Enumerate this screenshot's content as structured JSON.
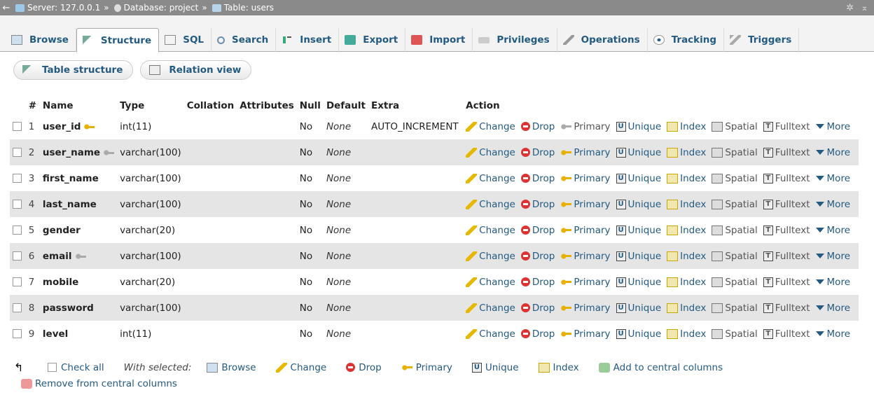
{
  "breadcrumb": {
    "server": "Server: 127.0.0.1",
    "database": "Database: project",
    "table": "Table: users",
    "separator": "»"
  },
  "tabs": [
    {
      "label": "Browse",
      "icon": "browse-icon",
      "active": false
    },
    {
      "label": "Structure",
      "icon": "structure-icon",
      "active": true
    },
    {
      "label": "SQL",
      "icon": "sql-icon",
      "active": false
    },
    {
      "label": "Search",
      "icon": "search-icon",
      "active": false
    },
    {
      "label": "Insert",
      "icon": "insert-icon",
      "active": false
    },
    {
      "label": "Export",
      "icon": "export-icon",
      "active": false
    },
    {
      "label": "Import",
      "icon": "import-icon",
      "active": false
    },
    {
      "label": "Privileges",
      "icon": "privileges-icon",
      "active": false
    },
    {
      "label": "Operations",
      "icon": "operations-icon",
      "active": false
    },
    {
      "label": "Tracking",
      "icon": "tracking-icon",
      "active": false
    },
    {
      "label": "Triggers",
      "icon": "triggers-icon",
      "active": false
    }
  ],
  "subtabs": [
    {
      "label": "Table structure",
      "icon": "table-structure-icon"
    },
    {
      "label": "Relation view",
      "icon": "relation-view-icon"
    }
  ],
  "columns": {
    "num": "#",
    "name": "Name",
    "type": "Type",
    "collation": "Collation",
    "attributes": "Attributes",
    "null": "Null",
    "default": "Default",
    "extra": "Extra",
    "action": "Action"
  },
  "actions": {
    "change": "Change",
    "drop": "Drop",
    "primary": "Primary",
    "unique": "Unique",
    "index": "Index",
    "spatial": "Spatial",
    "fulltext": "Fulltext",
    "more": "More"
  },
  "rows": [
    {
      "num": "1",
      "name": "user_id",
      "key": "primary",
      "type": "int(11)",
      "null": "No",
      "default": "None",
      "extra": "AUTO_INCREMENT"
    },
    {
      "num": "2",
      "name": "user_name",
      "key": "unique",
      "type": "varchar(100)",
      "null": "No",
      "default": "None",
      "extra": ""
    },
    {
      "num": "3",
      "name": "first_name",
      "key": "",
      "type": "varchar(100)",
      "null": "No",
      "default": "None",
      "extra": ""
    },
    {
      "num": "4",
      "name": "last_name",
      "key": "",
      "type": "varchar(100)",
      "null": "No",
      "default": "None",
      "extra": ""
    },
    {
      "num": "5",
      "name": "gender",
      "key": "",
      "type": "varchar(20)",
      "null": "No",
      "default": "None",
      "extra": ""
    },
    {
      "num": "6",
      "name": "email",
      "key": "unique",
      "type": "varchar(100)",
      "null": "No",
      "default": "None",
      "extra": ""
    },
    {
      "num": "7",
      "name": "mobile",
      "key": "",
      "type": "varchar(20)",
      "null": "No",
      "default": "None",
      "extra": ""
    },
    {
      "num": "8",
      "name": "password",
      "key": "",
      "type": "varchar(100)",
      "null": "No",
      "default": "None",
      "extra": ""
    },
    {
      "num": "9",
      "name": "level",
      "key": "",
      "type": "int(11)",
      "null": "No",
      "default": "None",
      "extra": ""
    }
  ],
  "footer": {
    "check_all": "Check all",
    "with_selected": "With selected:",
    "browse": "Browse",
    "change": "Change",
    "drop": "Drop",
    "primary": "Primary",
    "unique": "Unique",
    "index": "Index",
    "add_central": "Add to central columns",
    "remove_central": "Remove from central columns"
  },
  "colors": {
    "link": "#235a81",
    "topbar": "#8a8a8a",
    "row_alt": "#e5e5e5"
  }
}
